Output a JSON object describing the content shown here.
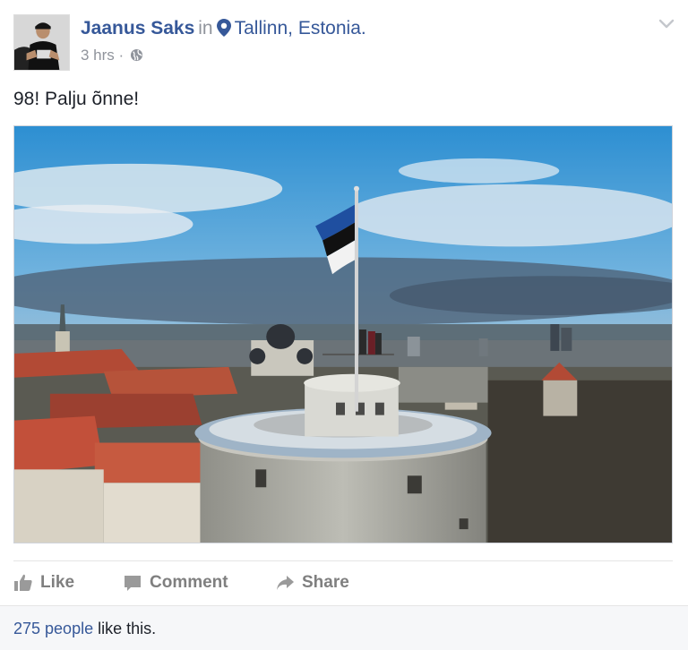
{
  "post": {
    "author": "Jaanus Saks",
    "in_word": "in",
    "location": "Tallinn, Estonia",
    "location_suffix": ".",
    "time": "3 hrs",
    "separator": "·",
    "privacy_icon": "globe-icon",
    "text": "98! Palju õnne!",
    "menu_icon": "chevron-down-icon"
  },
  "actions": {
    "like": "Like",
    "comment": "Comment",
    "share": "Share"
  },
  "likes": {
    "link": "275 people",
    "suffix": " like this."
  },
  "colors": {
    "link": "#365899",
    "muted": "#90949c",
    "action_gray": "#7f7f7f",
    "footer_bg": "#f6f7f9",
    "flag_blue": "#1f4fa0",
    "flag_black": "#111111",
    "flag_white": "#ffffff"
  }
}
